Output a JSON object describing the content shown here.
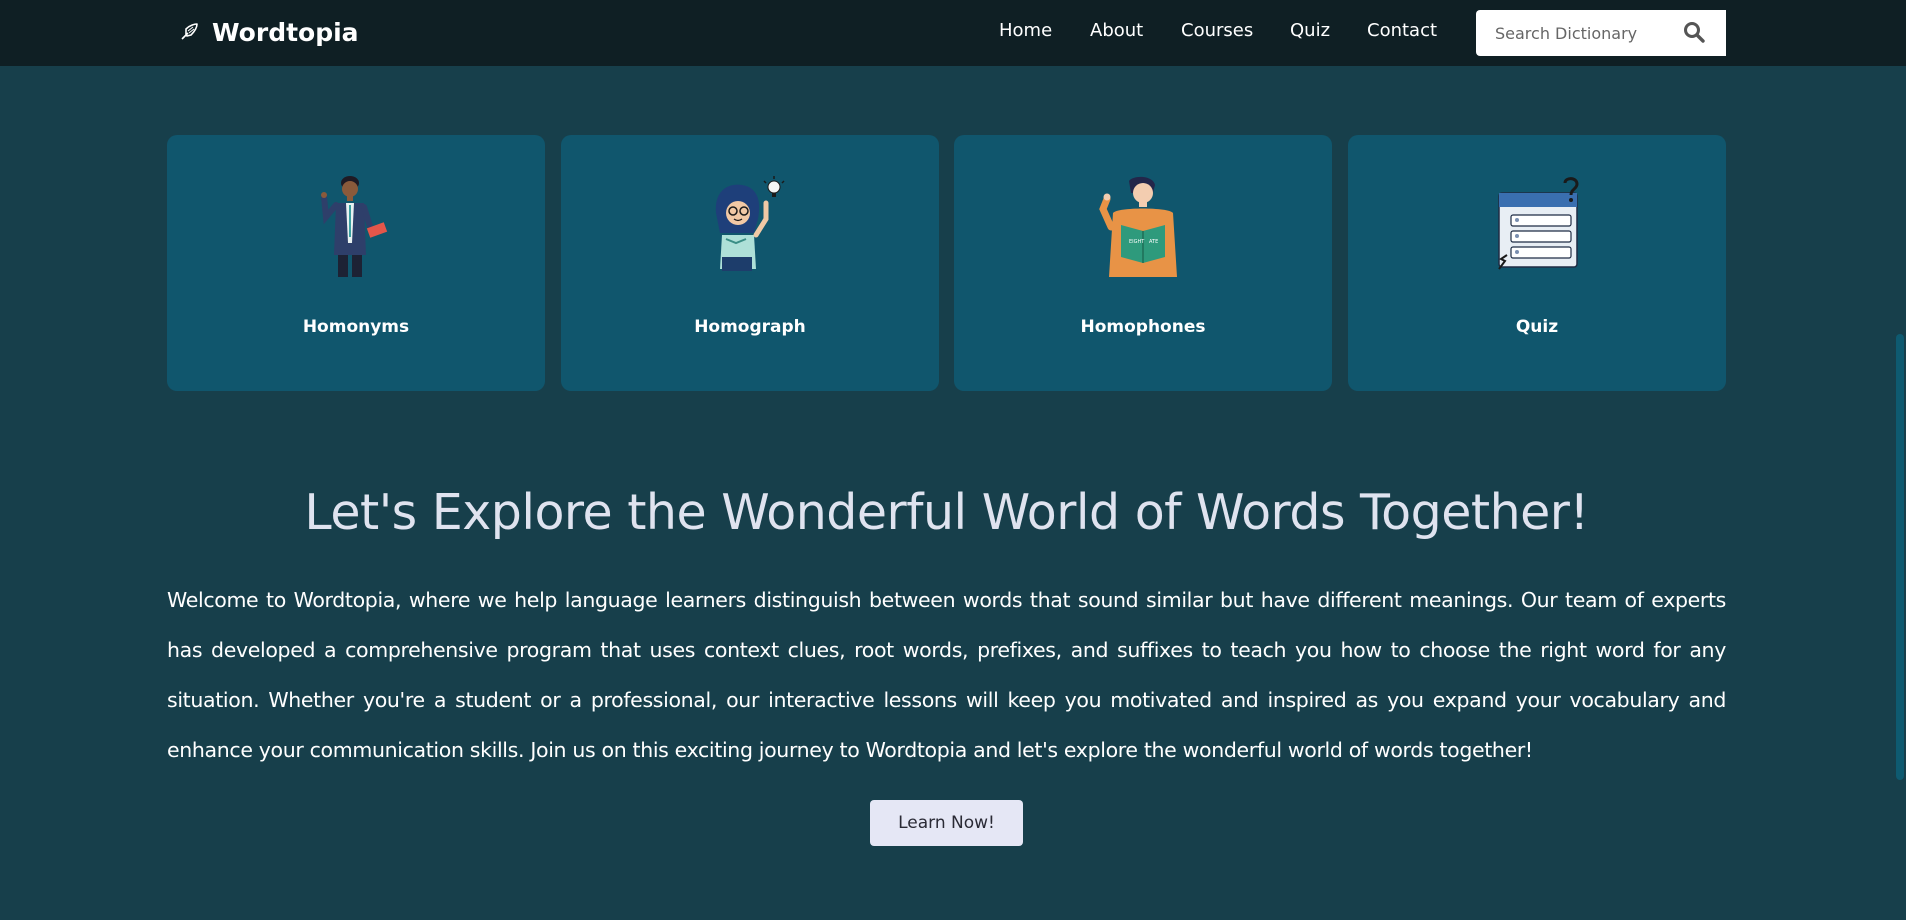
{
  "navbar": {
    "brand": "Wordtopia",
    "links": [
      "Home",
      "About",
      "Courses",
      "Quiz",
      "Contact"
    ],
    "search": {
      "placeholder": "Search Dictionary",
      "value": ""
    }
  },
  "cards": [
    {
      "title": "Homonyms"
    },
    {
      "title": "Homograph"
    },
    {
      "title": "Homophones"
    },
    {
      "title": "Quiz"
    }
  ],
  "hero": {
    "headline": "Let's Explore the Wonderful World of Words Together!",
    "intro": "Welcome to Wordtopia, where we help language learners distinguish between words that sound similar but have different meanings. Our team of experts has developed a comprehensive program that uses context clues, root words, prefixes, and suffixes to teach you how to choose the right word for any situation. Whether you're a student or a professional, our interactive lessons will keep you motivated and inspired as you expand your vocabulary and enhance your communication skills. Join us on this exciting journey to Wordtopia and let's explore the wonderful world of words together!",
    "cta_label": "Learn Now!"
  },
  "illustrations": {
    "card_1": {
      "book_text": ""
    },
    "card_3": {
      "book_left": "EIGHT",
      "book_right": "ATE"
    }
  },
  "colors": {
    "background": "#173f4b",
    "navbar": "#0f1f24",
    "card": "#10566d",
    "headline": "#dfe3ef",
    "button": "#e5e7f5"
  }
}
